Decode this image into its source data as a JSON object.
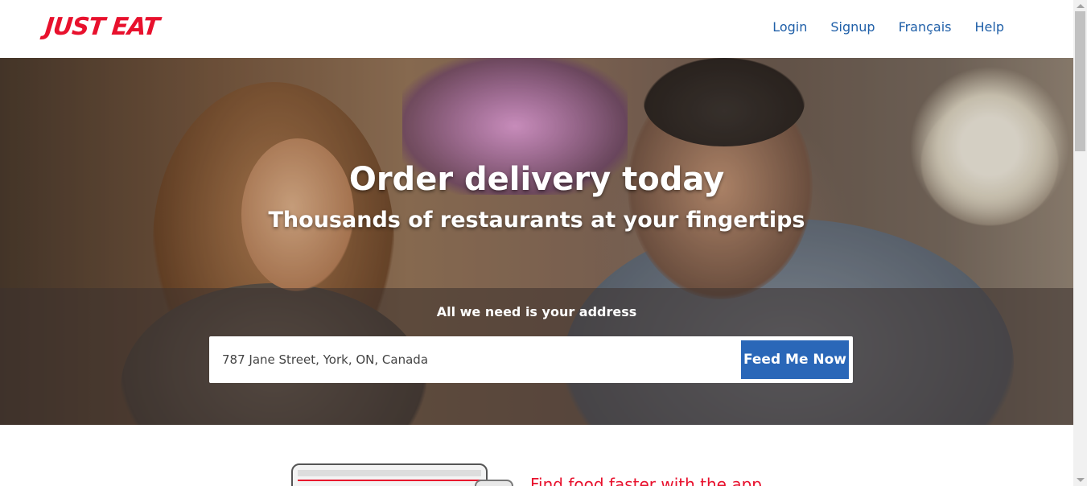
{
  "header": {
    "logo_text": "JUST EAT",
    "nav": {
      "login": "Login",
      "signup": "Signup",
      "francais": "Français",
      "help": "Help"
    }
  },
  "hero": {
    "title": "Order delivery today",
    "subtitle": "Thousands of restaurants at your fingertips",
    "search_label": "All we need is your address",
    "address_value": "787 Jane Street, York, ON, Canada",
    "button_label": "Feed Me Now"
  },
  "app_promo": {
    "heading": "Find food faster with the app"
  },
  "colors": {
    "brand_red": "#e8112d",
    "nav_blue": "#1f5fa8",
    "button_blue": "#2a67b8"
  }
}
